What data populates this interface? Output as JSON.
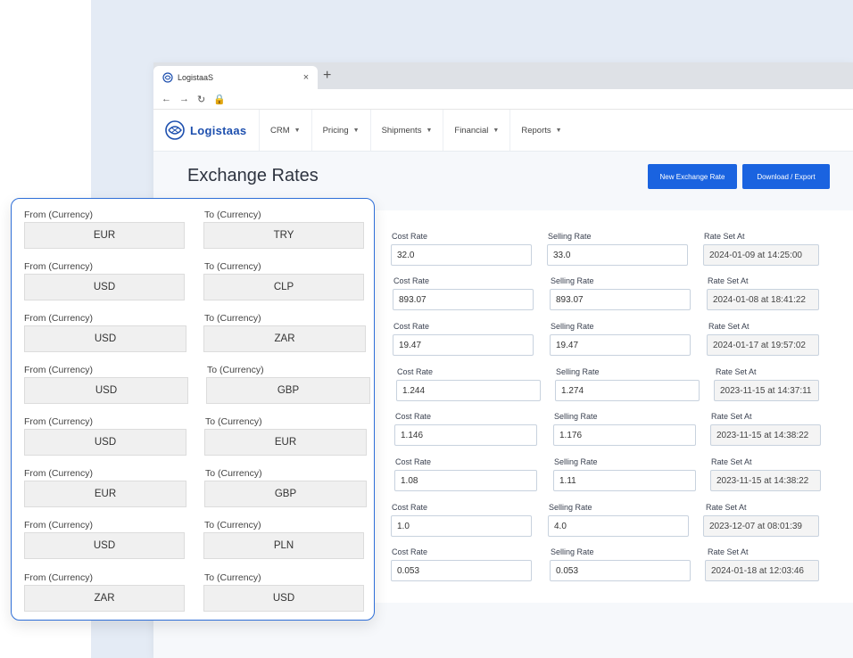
{
  "browser": {
    "tab_title": "LogistaaS",
    "tab_close": "×",
    "new_tab": "+",
    "nav_icons": [
      "back-arrow-icon",
      "forward-arrow-icon",
      "reload-icon",
      "lock-icon"
    ]
  },
  "app": {
    "brand": "Logistaas",
    "nav": [
      {
        "label": "CRM"
      },
      {
        "label": "Pricing"
      },
      {
        "label": "Shipments"
      },
      {
        "label": "Financial"
      },
      {
        "label": "Reports"
      }
    ],
    "page_title": "Exchange Rates",
    "buttons": {
      "new_label": "New Exchange Rate",
      "export_label": "Download / Export"
    },
    "accent_color": "#1a63e0"
  },
  "rates_labels": {
    "cost": "Cost Rate",
    "selling": "Selling Rate",
    "set_at": "Rate Set At"
  },
  "rates": [
    {
      "cost": "32.0",
      "selling": "33.0",
      "set_at": "2024-01-09 at 14:25:00"
    },
    {
      "cost": "893.07",
      "selling": "893.07",
      "set_at": "2024-01-08 at 18:41:22"
    },
    {
      "cost": "19.47",
      "selling": "19.47",
      "set_at": "2024-01-17 at 19:57:02"
    },
    {
      "cost": "1.244",
      "selling": "1.274",
      "set_at": "2023-11-15 at 14:37:11"
    },
    {
      "cost": "1.146",
      "selling": "1.176",
      "set_at": "2023-11-15 at 14:38:22"
    },
    {
      "cost": "1.08",
      "selling": "1.11",
      "set_at": "2023-11-15 at 14:38:22"
    },
    {
      "cost": "1.0",
      "selling": "4.0",
      "set_at": "2023-12-07 at 08:01:39"
    },
    {
      "cost": "0.053",
      "selling": "0.053",
      "set_at": "2024-01-18 at 12:03:46"
    }
  ],
  "overlay_labels": {
    "from": "From (Currency)",
    "to": "To (Currency)"
  },
  "currency_pairs": [
    {
      "from": "EUR",
      "to": "TRY"
    },
    {
      "from": "USD",
      "to": "CLP"
    },
    {
      "from": "USD",
      "to": "ZAR"
    },
    {
      "from": "USD",
      "to": "GBP"
    },
    {
      "from": "USD",
      "to": "EUR"
    },
    {
      "from": "EUR",
      "to": "GBP"
    },
    {
      "from": "USD",
      "to": "PLN"
    },
    {
      "from": "ZAR",
      "to": "USD"
    }
  ]
}
